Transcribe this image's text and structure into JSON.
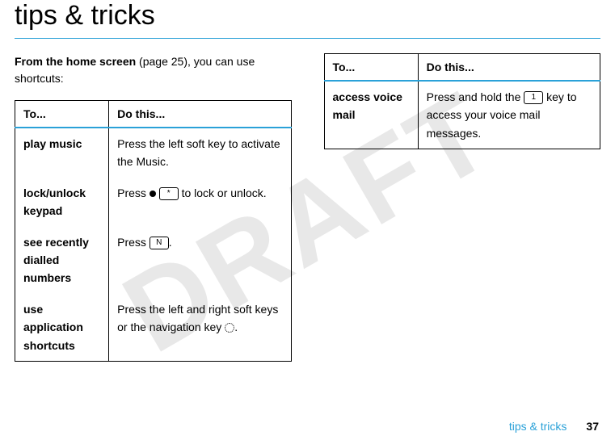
{
  "watermark": "DRAFT",
  "title": "tips & tricks",
  "intro_prefix": "From the home screen",
  "intro_suffix": " (page 25), you can use shortcuts:",
  "table_headers": {
    "to": "To...",
    "do": "Do this..."
  },
  "left_rows": [
    {
      "to": "play music",
      "do_pre": "Press the left soft key to activate the Music."
    },
    {
      "to": "lock/unlock keypad",
      "do_pre": "Press ",
      "icon1": "center-dot",
      "mid": " ",
      "key": "*",
      "do_post": " to lock or unlock."
    },
    {
      "to": "see recently dialled numbers",
      "do_pre": "Press ",
      "key": "N",
      "do_post": "."
    },
    {
      "to": "use application shortcuts",
      "do_pre": "Press the left and right soft keys or the navigation key ",
      "icon1": "nav-ring",
      "do_post": "."
    }
  ],
  "right_rows": [
    {
      "to": "access voice mail",
      "do_pre": "Press and hold the ",
      "key": "1",
      "do_post": " key to access your voice mail messages."
    }
  ],
  "footer": {
    "label": "tips & tricks",
    "page": "37"
  }
}
